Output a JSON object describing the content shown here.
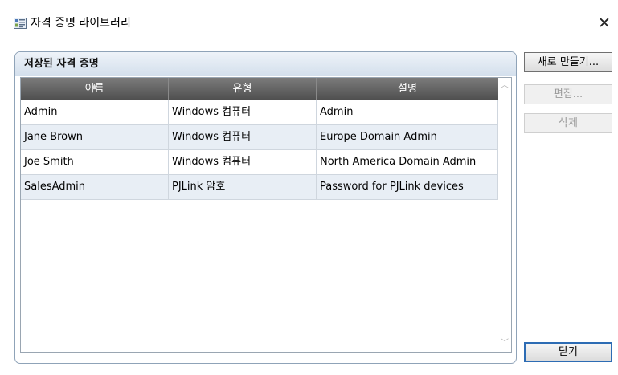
{
  "window": {
    "title": "자격 증명 라이브러리",
    "close_glyph": "✕",
    "icon": "library-app-icon"
  },
  "group": {
    "title": "저장된 자격 증명"
  },
  "table": {
    "columns": [
      "이름",
      "유형",
      "설명"
    ],
    "sorted_column": "이름",
    "rows": [
      [
        "Admin",
        "Windows 컴퓨터",
        "Admin"
      ],
      [
        "Jane Brown",
        "Windows 컴퓨터",
        "Europe Domain Admin"
      ],
      [
        "Joe Smith",
        "Windows 컴퓨터",
        "North America Domain Admin"
      ],
      [
        "SalesAdmin",
        "PJLink 암호",
        "Password for PJLink devices"
      ]
    ]
  },
  "buttons": {
    "new_label": "새로 만들기...",
    "edit_label": "편집...",
    "delete_label": "삭제",
    "close_label": "닫기"
  },
  "colors": {
    "header_gradient_top": "#7b7b7b",
    "header_gradient_bottom": "#4e4e4e",
    "alt_row": "#e8eef5",
    "focus_border": "#2d6cb4",
    "group_border": "#8fa3b8"
  }
}
